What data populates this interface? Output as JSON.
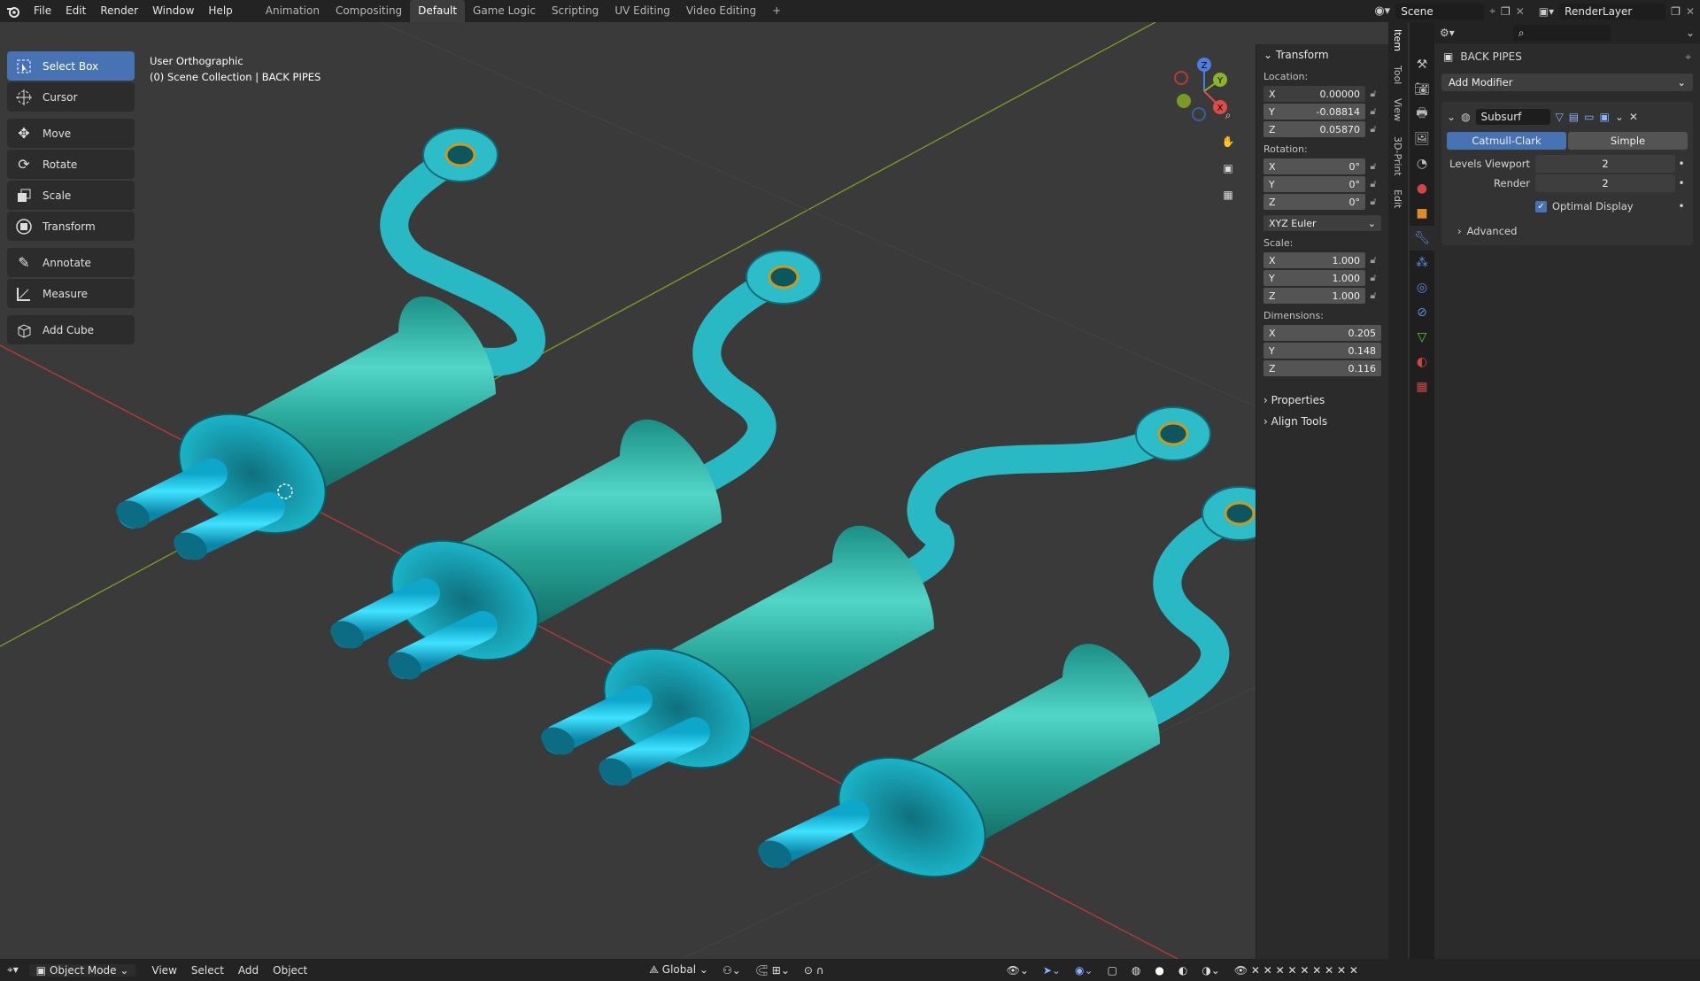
{
  "app_icon": "blender-logo-icon",
  "menu": [
    "File",
    "Edit",
    "Render",
    "Window",
    "Help"
  ],
  "workspaces": [
    "Animation",
    "Compositing",
    "Default",
    "Game Logic",
    "Scripting",
    "UV Editing",
    "Video Editing",
    "+"
  ],
  "active_workspace": "Default",
  "scene_name": "Scene",
  "render_layer": "RenderLayer",
  "tools": [
    {
      "label": "Select Box",
      "icon": "select-box-icon",
      "active": true
    },
    {
      "label": "Cursor",
      "icon": "cursor-icon"
    },
    {
      "label": "Move",
      "icon": "move-icon"
    },
    {
      "label": "Rotate",
      "icon": "rotate-icon"
    },
    {
      "label": "Scale",
      "icon": "scale-icon"
    },
    {
      "label": "Transform",
      "icon": "transform-icon"
    },
    {
      "label": "Annotate",
      "icon": "annotate-icon"
    },
    {
      "label": "Measure",
      "icon": "measure-icon"
    },
    {
      "label": "Add Cube",
      "icon": "add-cube-icon"
    }
  ],
  "viewport": {
    "view_name": "User Orthographic",
    "collection": "(0) Scene Collection | BACK PIPES"
  },
  "gizmo": {
    "x": "X",
    "y": "Y",
    "z": "Z"
  },
  "transform": {
    "title": "Transform",
    "location_label": "Location:",
    "location": {
      "x": "0.00000",
      "y": "-0.08814",
      "z": "0.05870"
    },
    "rotation_label": "Rotation:",
    "rotation": {
      "x": "0°",
      "y": "0°",
      "z": "0°"
    },
    "rotation_mode": "XYZ Euler",
    "scale_label": "Scale:",
    "scale": {
      "x": "1.000",
      "y": "1.000",
      "z": "1.000"
    },
    "dimensions_label": "Dimensions:",
    "dimensions": {
      "x": "0.205",
      "y": "0.148",
      "z": "0.116"
    },
    "properties": "Properties",
    "align_tools": "Align Tools"
  },
  "side_tabs": [
    "Item",
    "Tool",
    "View",
    "3D-Print",
    "Edit"
  ],
  "properties_panel": {
    "object_name": "BACK PIPES",
    "add_modifier": "Add Modifier",
    "modifier_name": "Subsurf",
    "catmull": "Catmull-Clark",
    "simple": "Simple",
    "levels_viewport_label": "Levels Viewport",
    "levels_viewport": "2",
    "render_label": "Render",
    "render": "2",
    "optimal_display": "Optimal Display",
    "advanced": "Advanced"
  },
  "bottom": {
    "mode": "Object Mode",
    "view": "View",
    "select": "Select",
    "add": "Add",
    "object": "Object",
    "orientation": "Global"
  },
  "colors": {
    "accent": "#4772b3",
    "pipe": "#1fc3e0",
    "muffler": "#2fa89a",
    "axis_x": "#b53a3a",
    "axis_y": "#7a9a26"
  }
}
